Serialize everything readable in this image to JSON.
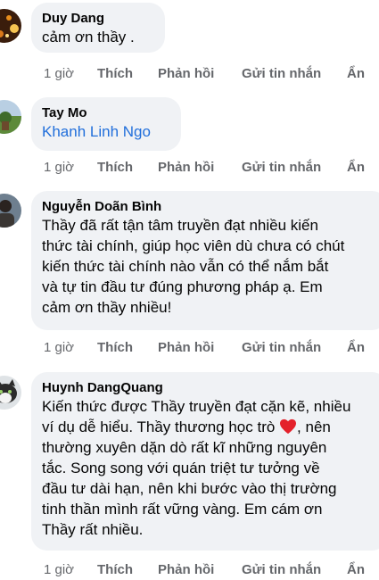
{
  "actions": {
    "time": "1 giờ",
    "like": "Thích",
    "reply": "Phản hồi",
    "message": "Gửi tin nhắn",
    "hide": "Ẩn"
  },
  "comments": [
    {
      "author": "Duy Dang",
      "text": "cảm ơn  thầy ."
    },
    {
      "author": "Tay Mo",
      "text": "Khanh Linh Ngo"
    },
    {
      "author": "Nguyễn Doãn Bình",
      "text": "Thầy đã rất tận tâm truyền đạt nhiều kiến\nthức tài chính, giúp học viên dù chưa có chút\nkiến thức tài chính nào vẫn có thể nắm bắt\nvà tự tin đầu tư đúng phương pháp ạ. Em\ncảm ơn thầy nhiều!"
    },
    {
      "author": "Huynh DangQuang",
      "text_before_heart": "Kiến thức được Thầy truyền đạt cặn kẽ, nhiều\nví dụ dễ hiểu. Thầy thương học trò ",
      "text_after_heart": ", nên\nthường xuyên dặn dò rất kĩ những nguyên\ntắc. Song song với quán triệt tư tưởng về\nđầu tư dài hạn, nên khi bước vào thị trường\ntinh thần mình rất vững vàng. Em cám ơn\nThầy rất nhiều."
    }
  ],
  "colors": {
    "bubble": "#f0f2f5",
    "action_text": "#65676b",
    "mention_link": "#216fdb",
    "heart": "#e4212b"
  }
}
